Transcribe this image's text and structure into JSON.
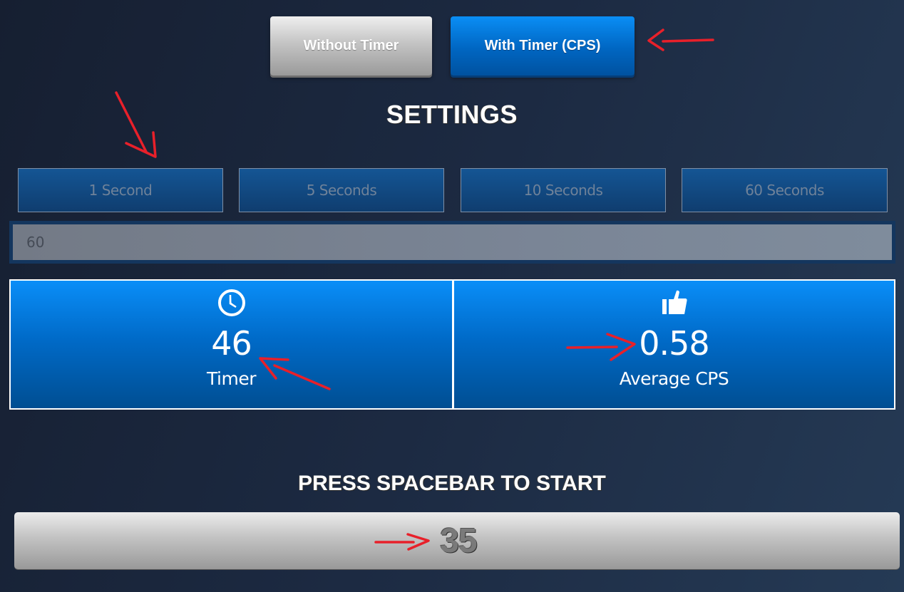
{
  "mode_tabs": {
    "without_timer": "Without Timer",
    "with_timer": "With Timer (CPS)",
    "active": "with_timer"
  },
  "settings": {
    "title": "SETTINGS",
    "durations": [
      {
        "label": "1 Second"
      },
      {
        "label": "5 Seconds"
      },
      {
        "label": "10 Seconds"
      },
      {
        "label": "60 Seconds"
      }
    ],
    "time_input_value": "60"
  },
  "stats": {
    "timer": {
      "icon": "clock-icon",
      "value": "46",
      "label": "Timer"
    },
    "average_cps": {
      "icon": "thumbs-up-icon",
      "value": "0.58",
      "label": "Average CPS"
    }
  },
  "click_panel": {
    "prompt": "PRESS SPACEBAR TO START",
    "count": "35"
  },
  "colors": {
    "accent_blue": "#0a8ef8",
    "annotation_red": "#e8202a"
  }
}
